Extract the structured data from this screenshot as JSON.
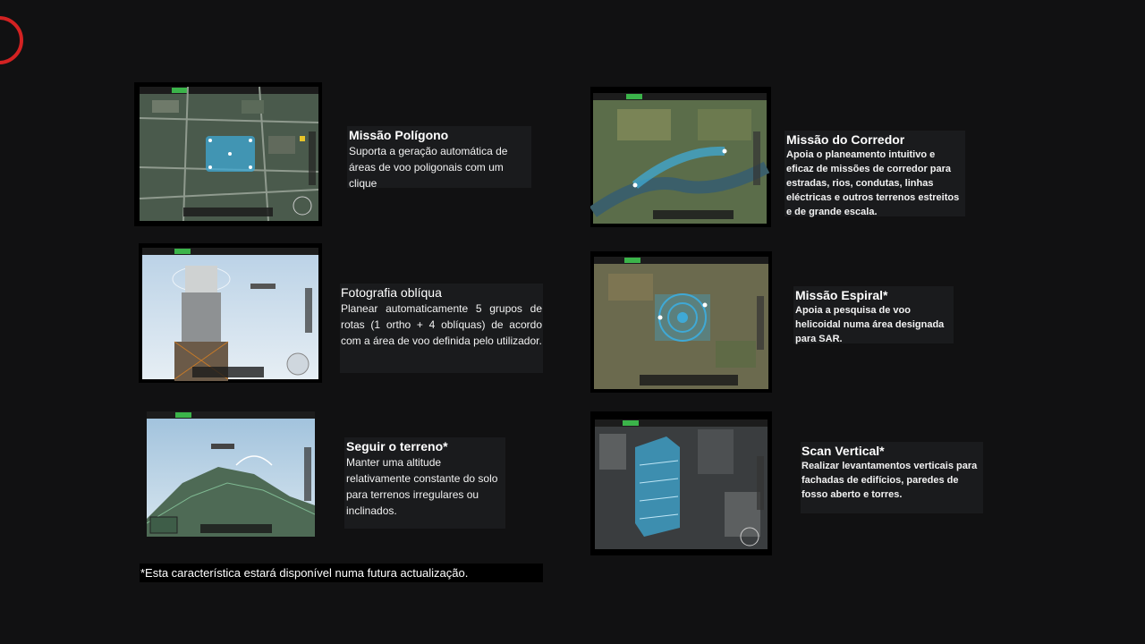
{
  "features": [
    {
      "id": "poligono",
      "title": "Missão Polígono",
      "body": "Suporta a geração automática de áreas de voo poligonais com um clique"
    },
    {
      "id": "obliqua",
      "title": "Fotografia oblíqua",
      "body": "Planear automaticamente 5 grupos de rotas (1 ortho + 4 oblíquas) de acordo com a área de voo definida pelo utilizador."
    },
    {
      "id": "terreno",
      "title": "Seguir o terreno*",
      "body": "Manter uma altitude relativamente constante do solo para terrenos irregulares ou inclinados."
    },
    {
      "id": "corredor",
      "title": "Missão do Corredor",
      "body": "Apoia o planeamento intuitivo e eficaz de missões de corredor para estradas, rios, condutas, linhas eléctricas e outros terrenos estreitos e de grande escala."
    },
    {
      "id": "espiral",
      "title": "Missão Espiral*",
      "body": "Apoia a pesquisa de voo helicoidal numa área designada para SAR."
    },
    {
      "id": "vertical",
      "title": "Scan Vertical*",
      "body": "Realizar levantamentos verticais para fachadas de edifícios, paredes de fosso aberto e torres."
    }
  ],
  "footnote": "*Esta característica estará disponível numa futura actualização.",
  "colors": {
    "accent": "#d32222",
    "background": "#111112",
    "card": "#1a1b1d",
    "map_highlight": "#3fa9d6"
  }
}
